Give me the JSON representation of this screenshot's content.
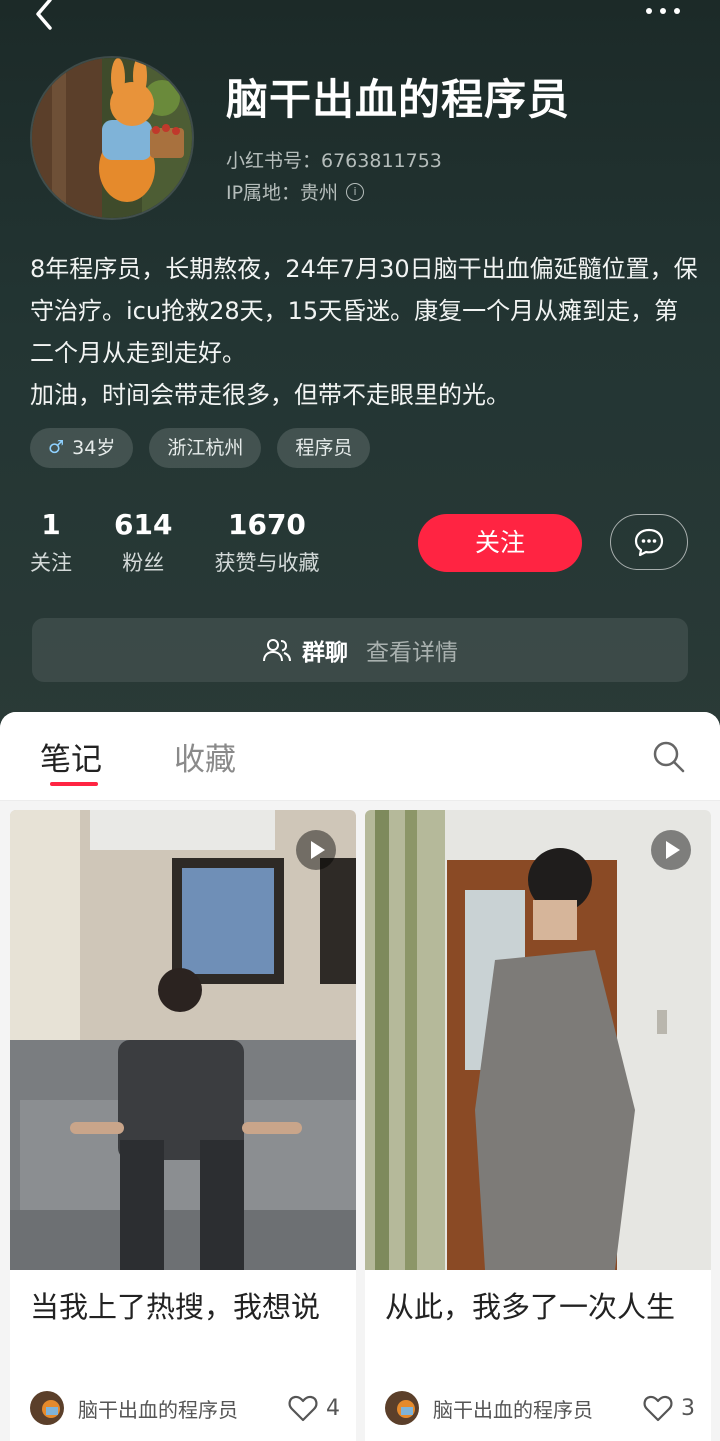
{
  "profile": {
    "name": "脑干出血的程序员",
    "id_line": "小红书号：6763811753",
    "ip_line": "IP属地：贵州",
    "bio_lines": [
      "8年程序员，长期熬夜，24年7月30日脑干出血偏延髓位置，保守治疗。icu抢救28天，15天昏迷。康复一个月从瘫到走，第二个月从走到走好。",
      "加油，时间会带走很多，但带不走眼里的光。"
    ],
    "tags": [
      "34岁",
      "浙江杭州",
      "程序员"
    ]
  },
  "stats": [
    {
      "value": "1",
      "label": "关注"
    },
    {
      "value": "614",
      "label": "粉丝"
    },
    {
      "value": "1670",
      "label": "获赞与收藏"
    }
  ],
  "actions": {
    "follow_label": "关注"
  },
  "group_bar": {
    "label": "群聊",
    "detail": "查看详情"
  },
  "tabs": {
    "notes": "笔记",
    "favorites": "收藏"
  },
  "posts": [
    {
      "title": "当我上了热搜，我想说",
      "author": "脑干出血的程序员",
      "likes": "4"
    },
    {
      "title": "从此，我多了一次人生",
      "author": "脑干出血的程序员",
      "likes": "3"
    }
  ],
  "colors": {
    "accent": "#ff2442",
    "header_bg": "#223331"
  }
}
